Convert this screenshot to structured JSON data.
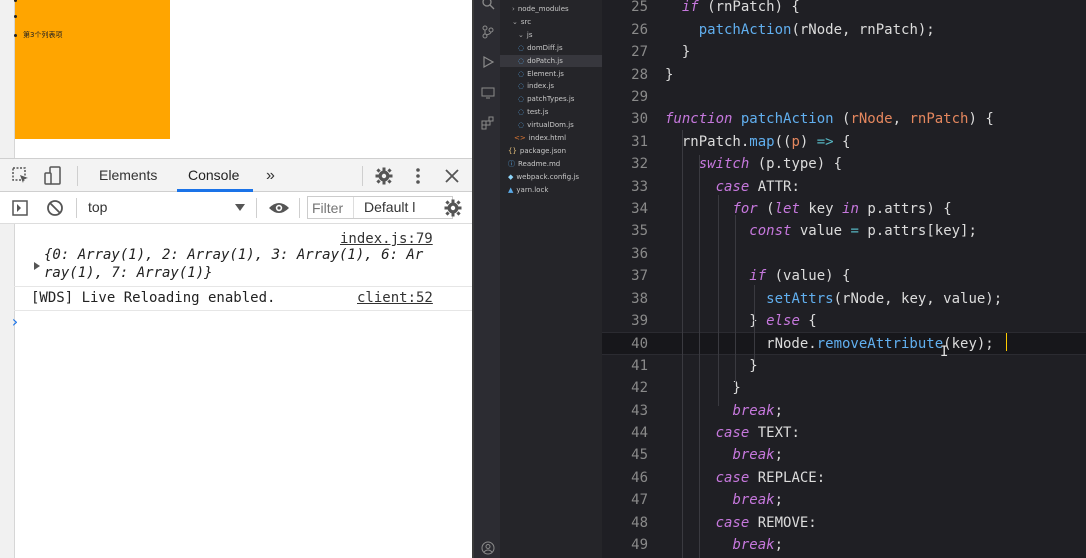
{
  "page": {
    "list_items": [
      "第3个列表项"
    ]
  },
  "devtools": {
    "tabs": {
      "elements": "Elements",
      "console": "Console",
      "more": "»"
    },
    "toolbar": {
      "context": "top",
      "filter_placeholder": "Filter",
      "levels": "Default l"
    },
    "log": [
      {
        "source": "index.js:79",
        "text_line1": "{0: Array(1), 2: Array(1), 3: Array(1), 6: Ar",
        "text_line2": "ray(1), 7: Array(1)}"
      },
      {
        "source": "client:52",
        "text": "[WDS] Live Reloading enabled."
      }
    ],
    "prompt": "›"
  },
  "explorer": {
    "items": [
      {
        "label": "node_modules",
        "icon": "chevron-right-icon"
      },
      {
        "label": "src",
        "icon": "chevron-down-icon"
      },
      {
        "label": "js",
        "icon": "chevron-down-icon"
      },
      {
        "label": "domDiff.js",
        "icon": "js-file-icon"
      },
      {
        "label": "doPatch.js",
        "icon": "js-file-icon",
        "selected": true
      },
      {
        "label": "Element.js",
        "icon": "js-file-icon"
      },
      {
        "label": "index.js",
        "icon": "js-file-icon"
      },
      {
        "label": "patchTypes.js",
        "icon": "js-file-icon"
      },
      {
        "label": "test.js",
        "icon": "js-file-icon"
      },
      {
        "label": "virtualDom.js",
        "icon": "js-file-icon"
      },
      {
        "label": "index.html",
        "icon": "html-file-icon"
      },
      {
        "label": "package.json",
        "icon": "json-file-icon"
      },
      {
        "label": "Readme.md",
        "icon": "info-file-icon"
      },
      {
        "label": "webpack.config.js",
        "icon": "webpack-file-icon"
      },
      {
        "label": "yarn.lock",
        "icon": "yarn-file-icon"
      }
    ]
  },
  "editor": {
    "active_line": 40,
    "lines": [
      {
        "n": "25",
        "tokens": [
          [
            "pl",
            "  "
          ],
          [
            "kw",
            "if"
          ],
          [
            "pl",
            " (rnPatch) {"
          ]
        ]
      },
      {
        "n": "26",
        "tokens": [
          [
            "pl",
            "    "
          ],
          [
            "fn",
            "patchAction"
          ],
          [
            "pl",
            "(rNode, rnPatch);"
          ]
        ]
      },
      {
        "n": "27",
        "tokens": [
          [
            "pl",
            "  }"
          ]
        ]
      },
      {
        "n": "28",
        "tokens": [
          [
            "pl",
            "}"
          ]
        ]
      },
      {
        "n": "29",
        "tokens": []
      },
      {
        "n": "30",
        "tokens": [
          [
            "kw",
            "function"
          ],
          [
            "pl",
            " "
          ],
          [
            "fn",
            "patchAction"
          ],
          [
            "pl",
            " ("
          ],
          [
            "pm",
            "rNode"
          ],
          [
            "pl",
            ", "
          ],
          [
            "pm",
            "rnPatch"
          ],
          [
            "pl",
            ") {"
          ]
        ]
      },
      {
        "n": "31",
        "tokens": [
          [
            "pl",
            "  rnPatch."
          ],
          [
            "fn",
            "map"
          ],
          [
            "pl",
            "(("
          ],
          [
            "pm",
            "p"
          ],
          [
            "pl",
            ") "
          ],
          [
            "op",
            "=>"
          ],
          [
            "pl",
            " {"
          ]
        ]
      },
      {
        "n": "32",
        "tokens": [
          [
            "pl",
            "    "
          ],
          [
            "kw",
            "switch"
          ],
          [
            "pl",
            " (p.type) {"
          ]
        ]
      },
      {
        "n": "33",
        "tokens": [
          [
            "pl",
            "      "
          ],
          [
            "kw",
            "case"
          ],
          [
            "pl",
            " ATTR:"
          ]
        ]
      },
      {
        "n": "34",
        "tokens": [
          [
            "pl",
            "        "
          ],
          [
            "kw",
            "for"
          ],
          [
            "pl",
            " ("
          ],
          [
            "kw",
            "let"
          ],
          [
            "pl",
            " key "
          ],
          [
            "kw",
            "in"
          ],
          [
            "pl",
            " p.attrs) {"
          ]
        ]
      },
      {
        "n": "35",
        "tokens": [
          [
            "pl",
            "          "
          ],
          [
            "kw",
            "const"
          ],
          [
            "pl",
            " value "
          ],
          [
            "op",
            "="
          ],
          [
            "pl",
            " p.attrs[key];"
          ]
        ]
      },
      {
        "n": "36",
        "tokens": []
      },
      {
        "n": "37",
        "tokens": [
          [
            "pl",
            "          "
          ],
          [
            "kw",
            "if"
          ],
          [
            "pl",
            " (value) {"
          ]
        ]
      },
      {
        "n": "38",
        "tokens": [
          [
            "pl",
            "            "
          ],
          [
            "fn",
            "setAttrs"
          ],
          [
            "pl",
            "(rNode, key, value);"
          ]
        ]
      },
      {
        "n": "39",
        "tokens": [
          [
            "pl",
            "          } "
          ],
          [
            "kw",
            "else"
          ],
          [
            "pl",
            " {"
          ]
        ]
      },
      {
        "n": "40",
        "tokens": [
          [
            "pl",
            "            rNode."
          ],
          [
            "fn",
            "removeAttribute"
          ],
          [
            "pl",
            "(key);"
          ]
        ]
      },
      {
        "n": "41",
        "tokens": [
          [
            "pl",
            "          }"
          ]
        ]
      },
      {
        "n": "42",
        "tokens": [
          [
            "pl",
            "        }"
          ]
        ]
      },
      {
        "n": "43",
        "tokens": [
          [
            "pl",
            "        "
          ],
          [
            "kw",
            "break"
          ],
          [
            "pl",
            ";"
          ]
        ]
      },
      {
        "n": "44",
        "tokens": [
          [
            "pl",
            "      "
          ],
          [
            "kw",
            "case"
          ],
          [
            "pl",
            " TEXT:"
          ]
        ]
      },
      {
        "n": "45",
        "tokens": [
          [
            "pl",
            "        "
          ],
          [
            "kw",
            "break"
          ],
          [
            "pl",
            ";"
          ]
        ]
      },
      {
        "n": "46",
        "tokens": [
          [
            "pl",
            "      "
          ],
          [
            "kw",
            "case"
          ],
          [
            "pl",
            " REPLACE:"
          ]
        ]
      },
      {
        "n": "47",
        "tokens": [
          [
            "pl",
            "        "
          ],
          [
            "kw",
            "break"
          ],
          [
            "pl",
            ";"
          ]
        ]
      },
      {
        "n": "48",
        "tokens": [
          [
            "pl",
            "      "
          ],
          [
            "kw",
            "case"
          ],
          [
            "pl",
            " REMOVE:"
          ]
        ]
      },
      {
        "n": "49",
        "tokens": [
          [
            "pl",
            "        "
          ],
          [
            "kw",
            "break"
          ],
          [
            "pl",
            ";"
          ]
        ]
      }
    ]
  },
  "colors": {
    "orange": "#ffa500",
    "accent": "#1a73e8",
    "editor_bg": "#1f1f24",
    "keyword": "#c678dd",
    "function": "#61afef",
    "param": "#e5875e"
  }
}
